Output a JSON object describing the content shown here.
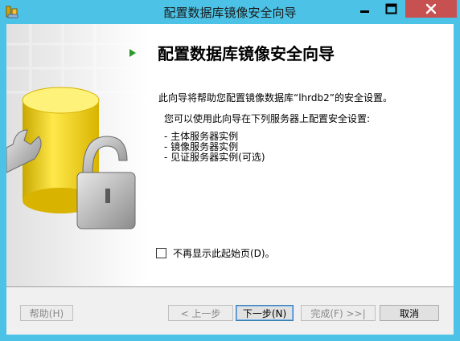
{
  "window": {
    "title": "配置数据库镜像安全向导",
    "min_glyph": "—",
    "close_glyph": "✕"
  },
  "wizard": {
    "heading": "配置数据库镜像安全向导",
    "description": "此向导将帮助您配置镜像数据库“lhrdb2”的安全设置。",
    "intro": "您可以使用此向导在下列服务器上配置安全设置:",
    "servers": [
      "- 主体服务器实例",
      "- 镜像服务器实例",
      "- 见证服务器实例(可选)"
    ],
    "dont_show_label": "不再显示此起始页(D)。"
  },
  "buttons": {
    "help": "帮助(H)",
    "prev": "< 上一步",
    "next": "下一步(N)",
    "finish": "完成(F) >>|",
    "cancel": "取消"
  }
}
